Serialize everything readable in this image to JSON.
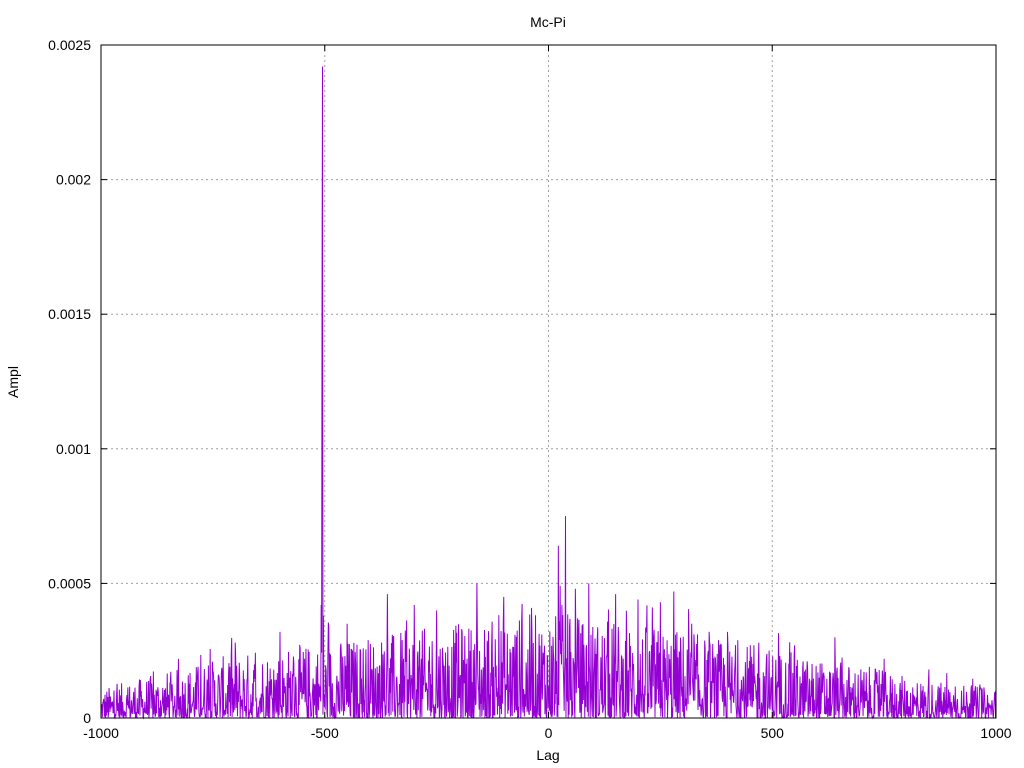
{
  "chart_data": {
    "type": "line",
    "title": "Mc-Pi",
    "xlabel": "Lag",
    "ylabel": "Ampl",
    "xlim": [
      -1000,
      1000
    ],
    "ylim": [
      0,
      0.0025
    ],
    "x_ticks": [
      -1000,
      -500,
      0,
      500,
      1000
    ],
    "y_ticks": [
      0,
      0.0005,
      0.001,
      0.0015,
      0.002,
      0.0025
    ],
    "x_tick_labels": [
      "-1000",
      "-500",
      "0",
      "500",
      "1000"
    ],
    "y_tick_labels": [
      "0",
      "0.0005",
      "0.001",
      "0.0015",
      "0.002",
      "0.0025"
    ],
    "grid": true,
    "legend": "none",
    "series": [
      {
        "color": "#9400d3",
        "x_start": -1000,
        "x_step": 1,
        "points_count": 2001,
        "envelope": [
          [
            -1000,
            5e-05
          ],
          [
            -900,
            7e-05
          ],
          [
            -800,
            9e-05
          ],
          [
            -700,
            0.00011
          ],
          [
            -600,
            0.00012
          ],
          [
            -500,
            0.00013
          ],
          [
            -400,
            0.00014
          ],
          [
            -300,
            0.00015
          ],
          [
            -200,
            0.00016
          ],
          [
            -100,
            0.00017
          ],
          [
            0,
            0.00018
          ],
          [
            100,
            0.00017
          ],
          [
            200,
            0.00016
          ],
          [
            300,
            0.00015
          ],
          [
            400,
            0.00013
          ],
          [
            500,
            0.00012
          ],
          [
            600,
            0.0001
          ],
          [
            700,
            9e-05
          ],
          [
            800,
            7e-05
          ],
          [
            900,
            6e-05
          ],
          [
            1000,
            5e-05
          ]
        ],
        "peaks": [
          {
            "x": -508,
            "y": 0.00042
          },
          {
            "x": -506,
            "y": 0.0016
          },
          {
            "x": -505,
            "y": 0.00242
          },
          {
            "x": -503,
            "y": 0.00038
          },
          {
            "x": -700,
            "y": 0.00028
          },
          {
            "x": -600,
            "y": 0.00032
          },
          {
            "x": -450,
            "y": 0.00035
          },
          {
            "x": -360,
            "y": 0.00046
          },
          {
            "x": -300,
            "y": 0.00042
          },
          {
            "x": -250,
            "y": 0.0004
          },
          {
            "x": -160,
            "y": 0.0005
          },
          {
            "x": -100,
            "y": 0.00045
          },
          {
            "x": -60,
            "y": 0.00036
          },
          {
            "x": 22,
            "y": 0.00064
          },
          {
            "x": 30,
            "y": 0.00042
          },
          {
            "x": 38,
            "y": 0.00075
          },
          {
            "x": 60,
            "y": 0.00048
          },
          {
            "x": 90,
            "y": 0.0005
          },
          {
            "x": 150,
            "y": 0.00046
          },
          {
            "x": 200,
            "y": 0.00044
          },
          {
            "x": 250,
            "y": 0.00043
          },
          {
            "x": 280,
            "y": 0.00047
          },
          {
            "x": 320,
            "y": 0.00035
          },
          {
            "x": 400,
            "y": 0.00032
          },
          {
            "x": 470,
            "y": 0.00028
          },
          {
            "x": 550,
            "y": 0.00027
          },
          {
            "x": 640,
            "y": 0.0003
          },
          {
            "x": 750,
            "y": 0.00022
          },
          {
            "x": 850,
            "y": 0.00018
          }
        ]
      }
    ]
  }
}
